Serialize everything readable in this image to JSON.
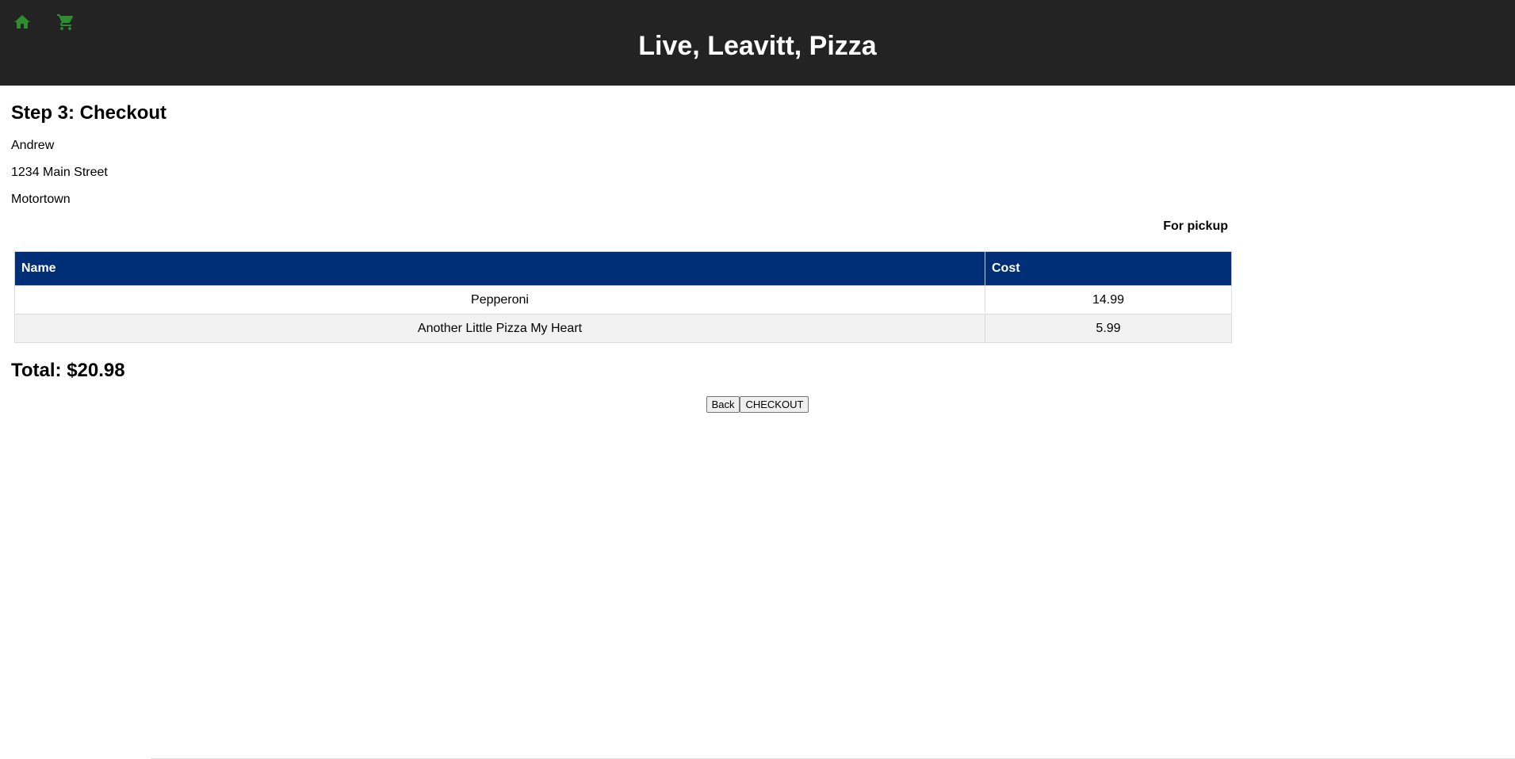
{
  "header": {
    "title": "Live, Leavitt, Pizza",
    "home_icon": "home-icon",
    "cart_icon": "cart-icon",
    "icon_color": "#2e8b2e"
  },
  "checkout": {
    "step_title": "Step 3: Checkout",
    "customer_name": "Andrew",
    "street": "1234 Main Street",
    "city": "Motortown",
    "delivery_mode": "For pickup",
    "table": {
      "headers": [
        "Name",
        "Cost"
      ],
      "rows": [
        {
          "name": "Pepperoni",
          "cost": "14.99"
        },
        {
          "name": "Another Little Pizza My Heart",
          "cost": "5.99"
        }
      ]
    },
    "total": "Total: $20.98",
    "back_label": "Back",
    "checkout_label": "CHECKOUT"
  },
  "colors": {
    "header_bg": "#232323",
    "table_header_bg": "#002f78"
  }
}
